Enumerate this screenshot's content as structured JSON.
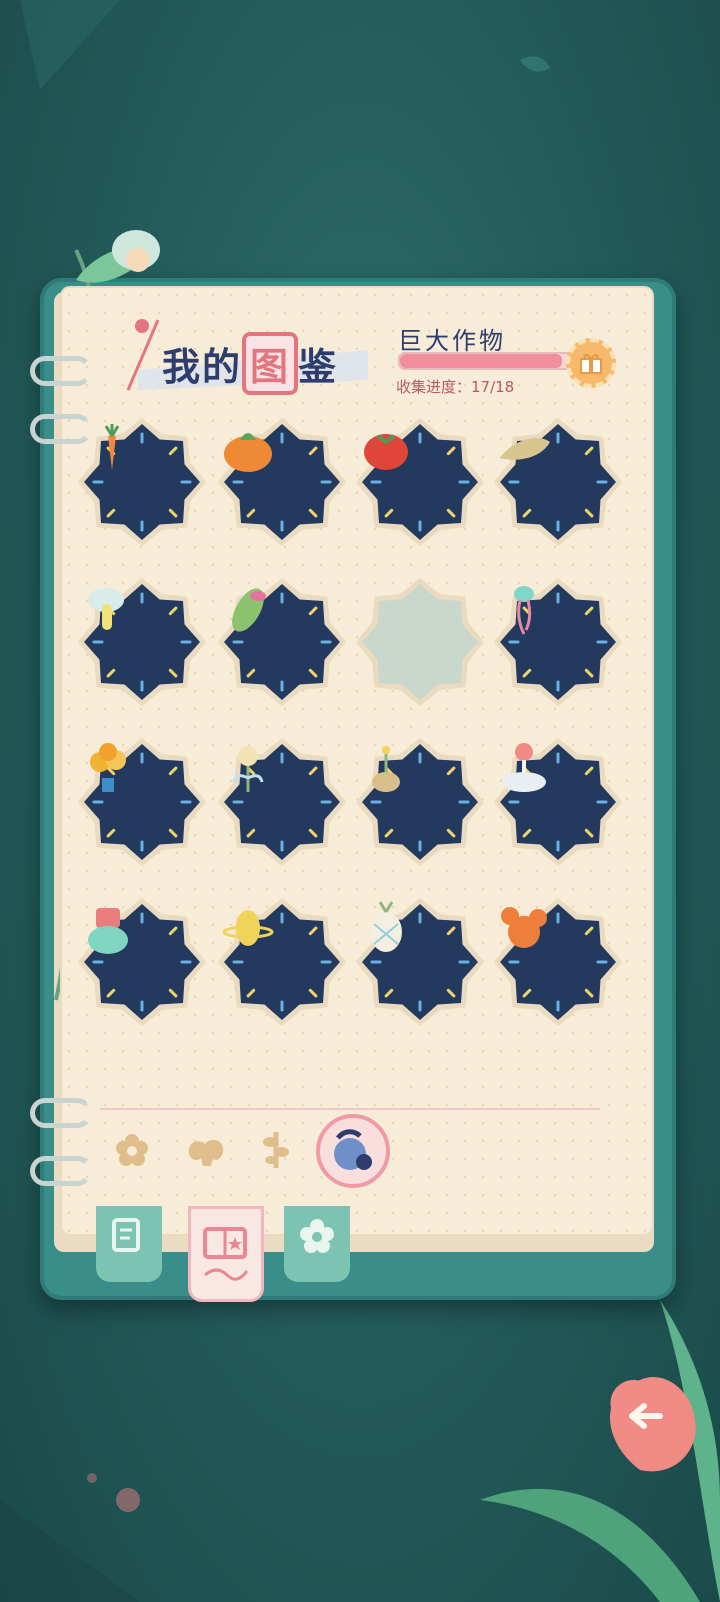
{
  "header": {
    "title_part1": "我的",
    "title_boxed": "图",
    "title_part2": "鉴",
    "category_name": "巨大作物",
    "progress_label": "收集进度：17/18",
    "progress_fraction": 0.944
  },
  "items": [
    {
      "name": "giant-carrot",
      "collected": true,
      "icon": "carrot-icon"
    },
    {
      "name": "giant-pumpkin",
      "collected": true,
      "icon": "pumpkin-icon"
    },
    {
      "name": "giant-tomato",
      "collected": true,
      "icon": "tomato-icon"
    },
    {
      "name": "giant-bamboo-shoot",
      "collected": true,
      "icon": "bamboo-shoot-icon"
    },
    {
      "name": "giant-mushroom",
      "collected": true,
      "icon": "mushroom-icon"
    },
    {
      "name": "giant-corn",
      "collected": true,
      "icon": "corn-icon"
    },
    {
      "name": "locked-slot",
      "collected": false,
      "icon": ""
    },
    {
      "name": "giant-jellyfish",
      "collected": true,
      "icon": "jellyfish-icon"
    },
    {
      "name": "giant-tree-pot",
      "collected": true,
      "icon": "tree-pot-icon"
    },
    {
      "name": "giant-flower",
      "collected": true,
      "icon": "flower-icon"
    },
    {
      "name": "giant-sprout-pot",
      "collected": true,
      "icon": "sprout-pot-icon"
    },
    {
      "name": "giant-cloud-berry",
      "collected": true,
      "icon": "cloud-berry-icon"
    },
    {
      "name": "giant-cup-slime",
      "collected": true,
      "icon": "cup-slime-icon"
    },
    {
      "name": "giant-lemon-planet",
      "collected": true,
      "icon": "lemon-planet-icon"
    },
    {
      "name": "giant-crystal-pineapple",
      "collected": true,
      "icon": "pineapple-icon"
    },
    {
      "name": "giant-cactus",
      "collected": true,
      "icon": "cactus-icon"
    }
  ],
  "colors": {
    "badge_navy": "#23395d",
    "badge_frame": "#eadbc0",
    "locked_fill": "#c9d7cd",
    "accent_pink": "#f08f9b"
  }
}
